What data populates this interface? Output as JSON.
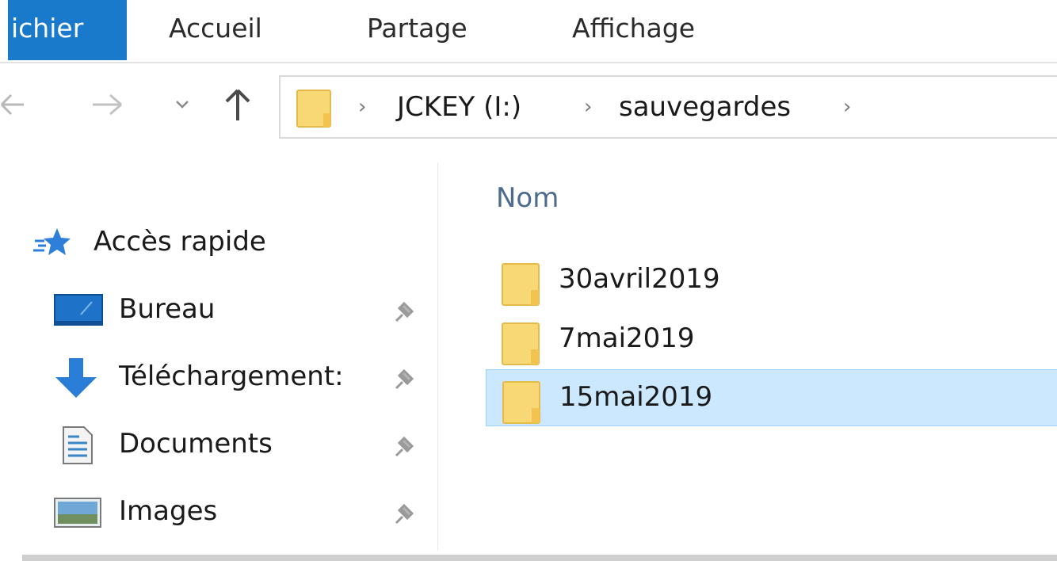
{
  "ribbon": {
    "tabs": [
      {
        "label": "ichier",
        "active": true
      },
      {
        "label": "Accueil"
      },
      {
        "label": "Partage"
      },
      {
        "label": "Affichage"
      }
    ]
  },
  "navigation": {
    "back_icon": "arrow-left-icon",
    "forward_icon": "arrow-right-icon",
    "recent_icon": "chevron-down-icon",
    "up_icon": "arrow-up-icon"
  },
  "address_bar": {
    "breadcrumbs": [
      "JCKEY (I:)",
      "sauvegardes"
    ],
    "separator": "›"
  },
  "sidebar": {
    "items": [
      {
        "label": "Accès rapide",
        "icon": "star-icon"
      },
      {
        "label": "Bureau",
        "icon": "desktop-icon",
        "pinned": true
      },
      {
        "label": "Téléchargement:",
        "icon": "download-arrow-icon",
        "pinned": true
      },
      {
        "label": "Documents",
        "icon": "document-icon",
        "pinned": true
      },
      {
        "label": "Images",
        "icon": "pictures-icon",
        "pinned": true
      }
    ]
  },
  "content": {
    "column_header": "Nom",
    "files": [
      {
        "name": "30avril2019",
        "type": "folder",
        "selected": false
      },
      {
        "name": "7mai2019",
        "type": "folder",
        "selected": false
      },
      {
        "name": "15mai2019",
        "type": "folder",
        "selected": true
      }
    ]
  },
  "colors": {
    "accent": "#1979ca",
    "selection_bg": "#cce8ff",
    "selection_border": "#99d1ff",
    "folder": "#f8d775",
    "header_text": "#4d6b8c"
  }
}
